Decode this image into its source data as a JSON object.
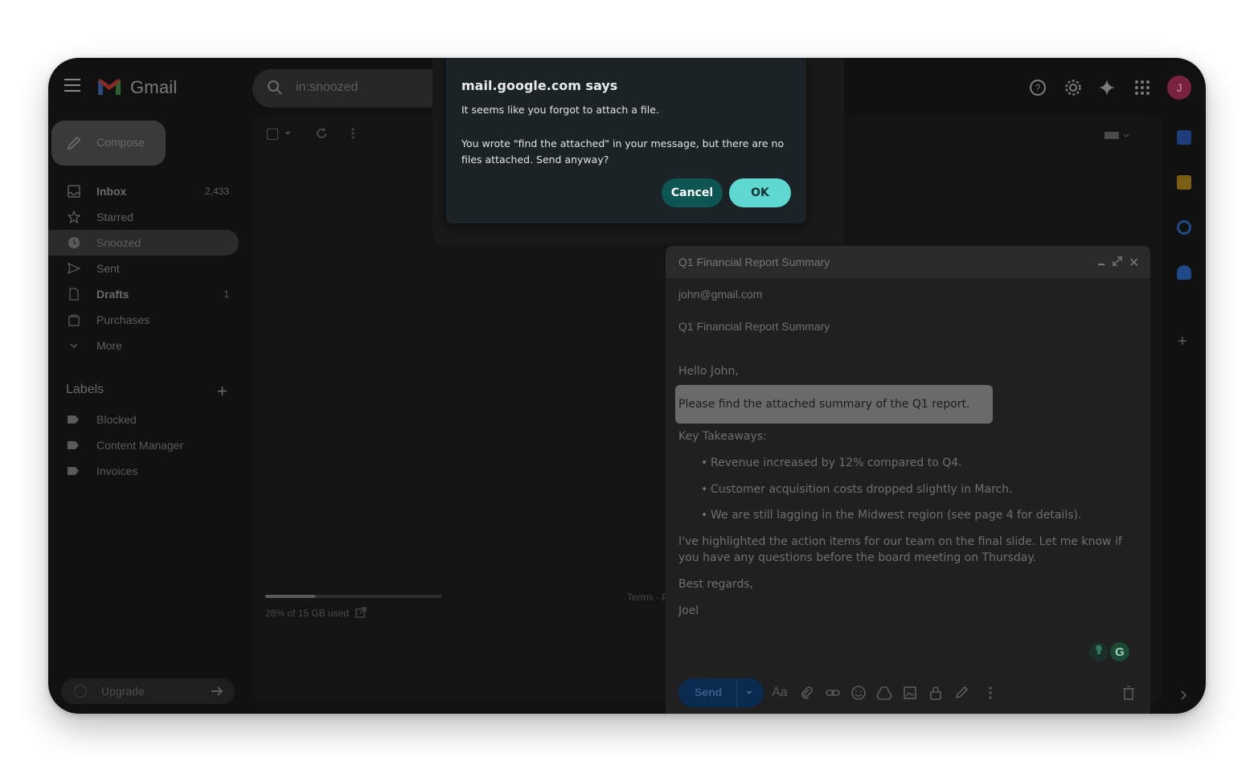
{
  "app": {
    "name": "Gmail"
  },
  "search": {
    "value": "in:snoozed"
  },
  "header_icons": [
    "help-icon",
    "settings-icon",
    "gemini-icon",
    "apps-icon"
  ],
  "avatar_initial": "J",
  "sidebar": {
    "compose_label": "Compose",
    "items": [
      {
        "label": "Inbox",
        "count": "2,433",
        "icon": "inbox-icon",
        "bold": true
      },
      {
        "label": "Starred",
        "count": "",
        "icon": "star-icon"
      },
      {
        "label": "Snoozed",
        "count": "",
        "icon": "clock-icon",
        "active": true
      },
      {
        "label": "Sent",
        "count": "",
        "icon": "send-icon"
      },
      {
        "label": "Drafts",
        "count": "1",
        "icon": "draft-icon",
        "bold": true
      },
      {
        "label": "Purchases",
        "count": "",
        "icon": "bag-icon"
      },
      {
        "label": "More",
        "count": "",
        "icon": "chevron-down-icon"
      }
    ],
    "labels_heading": "Labels",
    "labels": [
      "Blocked",
      "Content Manager",
      "Invoices"
    ],
    "upgrade_label": "Upgrade"
  },
  "main": {
    "storage_text": "28% of 15 GB used",
    "storage_fraction": 0.28,
    "terms_text": "Terms · P"
  },
  "compose_window": {
    "title": "Q1 Financial Report Summary",
    "to": "john@gmail.com",
    "subject": "Q1 Financial Report Summary",
    "greeting": "Hello John,",
    "highlighted_line": "Please find the attached summary of the Q1 report.",
    "takeaways_heading": "Key Takeaways:",
    "bullets": [
      "Revenue increased by 12% compared to Q4.",
      "Customer acquisition costs dropped slightly in March.",
      "We are still lagging in the Midwest region (see page 4 for details)."
    ],
    "paragraph": "I've highlighted the action items for our team on the final slide. Let me know if you have any questions before the board meeting on Thursday.",
    "closing": "Best regards,",
    "signature": "Joel",
    "send_label": "Send",
    "format_label": "Aa"
  },
  "dialog": {
    "title": "mail.google.com says",
    "line1": "It seems like you forgot to attach a file.",
    "line2": "You wrote \"find the attached\" in your message, but there are no files attached. Send anyway?",
    "cancel_label": "Cancel",
    "ok_label": "OK",
    "colors": {
      "cancel": "#0e5653",
      "ok": "#5fd8d2"
    }
  }
}
